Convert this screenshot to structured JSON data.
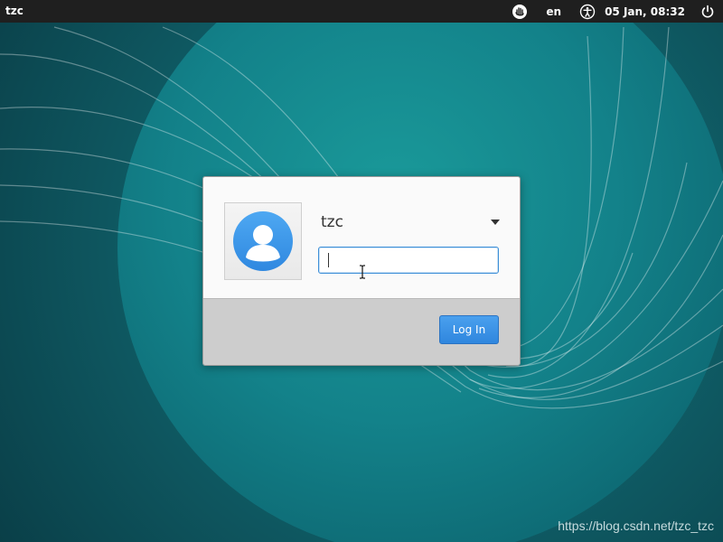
{
  "panel": {
    "hostname": "tzc",
    "language": "en",
    "clock": "05 Jan, 08:32",
    "icons": {
      "indicator": "hand-indicator-icon",
      "accessibility": "accessibility-icon",
      "power": "power-icon"
    }
  },
  "login": {
    "username": "tzc",
    "password_value": "",
    "login_label": "Log In",
    "accent_color": "#3d8fd8",
    "avatar_color": "#3a9ae8"
  },
  "watermark": "https://blog.csdn.net/tzc_tzc"
}
